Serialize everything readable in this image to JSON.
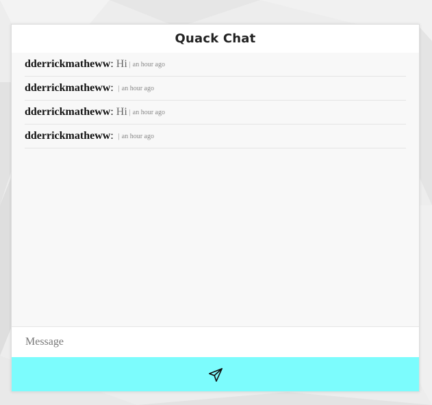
{
  "app": {
    "title": "Quack Chat"
  },
  "messages": [
    {
      "user": "dderrickmatheww",
      "text": "Hi",
      "time": "an hour ago"
    },
    {
      "user": "dderrickmatheww",
      "text": "",
      "time": "an hour ago"
    },
    {
      "user": "dderrickmatheww",
      "text": "Hi",
      "time": "an hour ago"
    },
    {
      "user": "dderrickmatheww",
      "text": "",
      "time": "an hour ago"
    }
  ],
  "composer": {
    "placeholder": "Message",
    "value": "",
    "send_icon": "paper-plane-icon"
  },
  "colors": {
    "send_button": "#7cfcfd",
    "card_background": "#f8f8f8",
    "header_background": "#ffffff",
    "page_background": "#ececec"
  }
}
